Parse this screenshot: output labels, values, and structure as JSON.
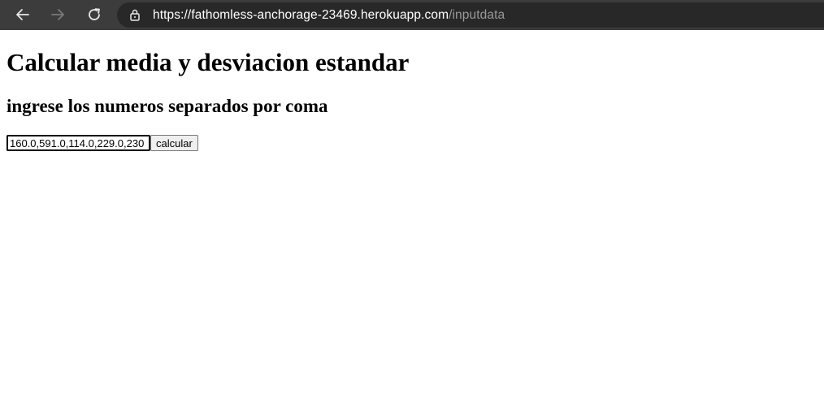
{
  "browser": {
    "url_host": "https://fathomless-anchorage-23469.herokuapp.com",
    "url_path": "/inputdata",
    "icons": {
      "back": "arrow-left-icon",
      "forward": "arrow-right-icon",
      "reload": "reload-icon",
      "lock": "lock-icon"
    }
  },
  "page": {
    "title": "Calcular media y desviacion estandar",
    "subtitle": "ingrese los numeros separados por coma",
    "input_value": "160.0,591.0,114.0,229.0,230",
    "button_label": "calcular"
  }
}
